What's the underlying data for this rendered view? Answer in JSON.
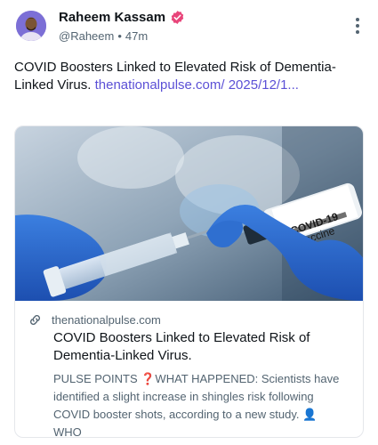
{
  "author": {
    "display_name": "Raheem Kassam",
    "handle": "@Raheem",
    "separator": "•",
    "time_ago": "47m"
  },
  "post": {
    "text": "COVID Boosters Linked to Elevated Risk of Dementia-Linked Virus. ",
    "link_text": "thenationalpulse.com/ 2025/12/1..."
  },
  "card": {
    "image_label_line1": "COVID-19",
    "image_label_line2": "Vaccine",
    "domain": "thenationalpulse.com",
    "title": "COVID Boosters Linked to Elevated Risk of Dementia-Linked Virus.",
    "description": "PULSE POINTS ❓WHAT HAPPENED: Scientists have identified a slight increase in shingles risk following COVID booster shots, according to a new study. 👤 WHO"
  },
  "icons": {
    "verified": "verified-badge-icon",
    "more": "more-vertical-icon",
    "link": "link-icon"
  },
  "colors": {
    "link": "#5b50d6",
    "verified": "#e8457a",
    "secondary_text": "#536471"
  }
}
